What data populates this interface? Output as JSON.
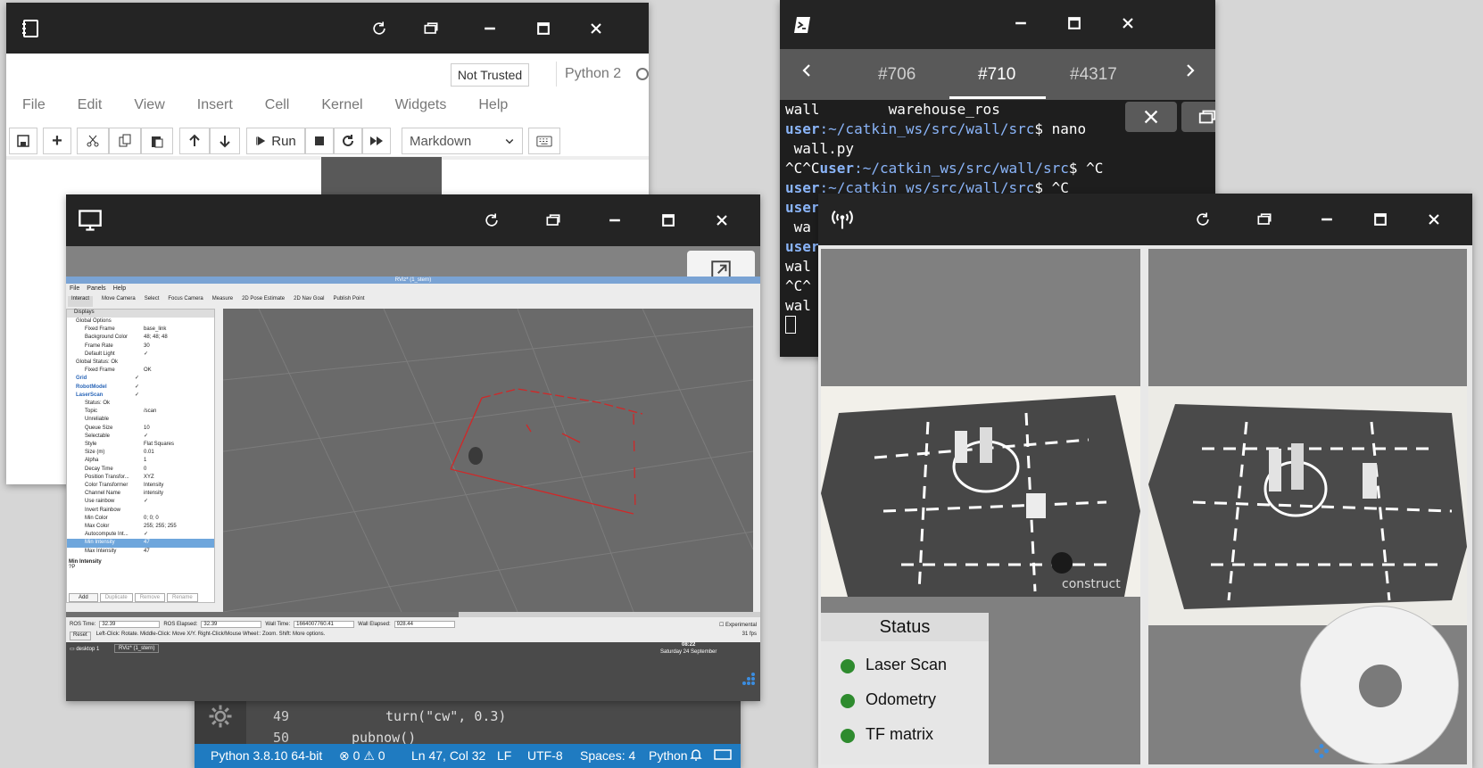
{
  "jupyter": {
    "trusted": "Not Trusted",
    "kernel": "Python 2",
    "menu": [
      "File",
      "Edit",
      "View",
      "Insert",
      "Cell",
      "Kernel",
      "Widgets",
      "Help"
    ],
    "run_label": "Run",
    "cell_type": "Markdown"
  },
  "terminal": {
    "tabs": [
      "#706",
      "#710",
      "#4317"
    ],
    "active_tab": "#710",
    "lines": [
      {
        "a": "wall",
        "b": "        warehouse_ros"
      },
      {
        "u": "user",
        "p": ":~/catkin_ws/src/wall/src",
        "t": "$ nano"
      },
      {
        "a": " wall.py"
      },
      {
        "a": "^C^C",
        "u": "user",
        "p": ":~/catkin_ws/src/wall/src",
        "t": "$ ^C"
      },
      {
        "u": "user",
        "p": ":~/catkin_ws/src/wall/src",
        "t": "$ ^C"
      },
      {
        "u": "user"
      },
      {
        "a": " wa"
      },
      {
        "u": "user"
      },
      {
        "a": "wal"
      },
      {
        "a": "^C^"
      },
      {
        "a": "wal"
      }
    ]
  },
  "rviz": {
    "title": "RViz* (1_stern)",
    "menu": [
      "File",
      "Panels",
      "Help"
    ],
    "tools": [
      "Interact",
      "Move Camera",
      "Select",
      "Focus Camera",
      "Measure",
      "2D Pose Estimate",
      "2D Nav Goal",
      "Publish Point"
    ],
    "displays_header": "Displays",
    "tree": [
      {
        "k": "Global Options",
        "v": ""
      },
      {
        "k": "Fixed Frame",
        "v": "base_link"
      },
      {
        "k": "Background Color",
        "v": "48; 48; 48"
      },
      {
        "k": "Frame Rate",
        "v": "30"
      },
      {
        "k": "Default Light",
        "v": "✓"
      },
      {
        "k": "Global Status: Ok",
        "v": ""
      },
      {
        "k": "Fixed Frame",
        "v": "OK"
      },
      {
        "k": "Grid",
        "v": "✓"
      },
      {
        "k": "RobotModel",
        "v": "✓"
      },
      {
        "k": "LaserScan",
        "v": "✓"
      },
      {
        "k": "Status: Ok",
        "v": ""
      },
      {
        "k": "Topic",
        "v": "/scan"
      },
      {
        "k": "Unreliable",
        "v": ""
      },
      {
        "k": "Queue Size",
        "v": "10"
      },
      {
        "k": "Selectable",
        "v": "✓"
      },
      {
        "k": "Style",
        "v": "Flat Squares"
      },
      {
        "k": "Size (m)",
        "v": "0.01"
      },
      {
        "k": "Alpha",
        "v": "1"
      },
      {
        "k": "Decay Time",
        "v": "0"
      },
      {
        "k": "Position Transfor...",
        "v": "XYZ"
      },
      {
        "k": "Color Transformer",
        "v": "Intensity"
      },
      {
        "k": "Channel Name",
        "v": "intensity"
      },
      {
        "k": "Use rainbow",
        "v": "✓"
      },
      {
        "k": "Invert Rainbow",
        "v": ""
      },
      {
        "k": "Min Color",
        "v": "0; 0; 0"
      },
      {
        "k": "Max Color",
        "v": "255; 255; 255"
      },
      {
        "k": "Autocompute Int...",
        "v": "✓"
      },
      {
        "k": "Min Intensity",
        "v": "47"
      },
      {
        "k": "Max Intensity",
        "v": "47"
      }
    ],
    "help_title": "Min Intensity",
    "help_text": "?P",
    "buttons": [
      "Add",
      "Duplicate",
      "Remove",
      "Rename"
    ],
    "ros_time_label": "ROS Time:",
    "ros_time": "32.39",
    "ros_elapsed_label": "ROS Elapsed:",
    "ros_elapsed": "32.39",
    "wall_time_label": "Wall Time:",
    "wall_time": "1664007760.41",
    "wall_elapsed_label": "Wall Elapsed:",
    "wall_elapsed": "928.44",
    "experimental": "Experimental",
    "reset": "Reset",
    "hint": "Left-Click: Rotate. Middle-Click: Move X/Y. Right-Click/Mouse Wheel:: Zoom. Shift: More options.",
    "fps": "31 fps",
    "taskbar_desktop": "desktop 1",
    "taskbar_app": "RViz* (1_stern)",
    "clock_time": "08:22",
    "clock_date": "Saturday 24 September"
  },
  "editor": {
    "lines": [
      {
        "n": "49",
        "code": "turn(\"cw\", 0.3)"
      },
      {
        "n": "50",
        "code": "pubnow()"
      }
    ],
    "status": {
      "python": "Python 3.8.10 64-bit",
      "errors": "0",
      "warnings": "0",
      "position": "Ln 47, Col 32",
      "eol": "LF",
      "encoding": "UTF-8",
      "spaces": "Spaces: 4",
      "language": "Python"
    }
  },
  "camera": {
    "status_title": "Status",
    "items": [
      "Laser Scan",
      "Odometry",
      "TF matrix"
    ],
    "brand": "construct"
  },
  "colors": {
    "titlebar": "#242424",
    "vscode_status": "#1f7bc1",
    "terminal_user": "#8ab4f8",
    "status_green": "#2e8b2e"
  }
}
